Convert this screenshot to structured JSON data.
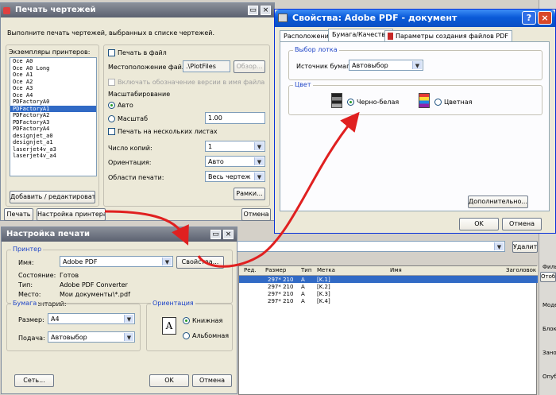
{
  "plot_dialog": {
    "title": "Печать чертежей",
    "instruction": "Выполните печать чертежей, выбранных в списке чертежей.",
    "printers_label": "Экземпляры принтеров:",
    "printers": [
      "Oce A0",
      "Oce A0 Long",
      "Oce A1",
      "Oce A2",
      "Oce A3",
      "Oce A4",
      "PDFactoryA0",
      "PDFactoryA1",
      "PDFactoryA2",
      "PDFactoryA3",
      "PDFactoryA4",
      "designjet_a0",
      "designjet_a1",
      "laserjet4v_a3",
      "laserjet4v_a4"
    ],
    "selected_printer_index": 7,
    "add_edit_button": "Добавить / редактировать...",
    "print_to_file": "Печать в файл",
    "file_location_label": "Местоположение файлов:",
    "file_location_value": ".\\PlotFiles",
    "browse_button": "Обзор...",
    "include_version": "Включать обозначение версии в имя файла",
    "scaling_label": "Масштабирование",
    "auto": "Авто",
    "scale": "Масштаб",
    "scale_value": "1.00",
    "multi_sheet": "Печать на нескольких листах",
    "copies_label": "Число копий:",
    "copies_value": "1",
    "orientation_label": "Ориентация:",
    "orientation_value": "Авто",
    "print_area_label": "Области печати:",
    "print_area_value": "Весь чертеж",
    "frames_button": "Рамки...",
    "print_button": "Печать",
    "printer_setup_button": "Настройка принтера...",
    "cancel_button": "Отмена"
  },
  "pdf_props": {
    "title": "Свойства: Adobe PDF - документ",
    "tabs": [
      "Расположение",
      "Бумага/Качество",
      "Параметры создания файлов PDF"
    ],
    "active_tab": 1,
    "tray_group": "Выбор лотка",
    "paper_source_label": "Источник бумаги:",
    "paper_source_value": "Автовыбор",
    "color_group": "Цвет",
    "bw": "Черно-белая",
    "color": "Цветная",
    "advanced_button": "Дополнительно...",
    "ok": "OK",
    "cancel": "Отмена"
  },
  "print_setup": {
    "title": "Настройка печати",
    "printer_group": "Принтер",
    "name_label": "Имя:",
    "name_value": "Adobe PDF",
    "properties_button": "Свойства...",
    "status_label": "Состояние:",
    "status_value": "Готов",
    "type_label": "Тип:",
    "type_value": "Adobe PDF Converter",
    "where_label": "Место:",
    "where_value": "Мои документы\\*.pdf",
    "comment_label": "Комментарий:",
    "paper_group": "Бумага",
    "size_label": "Размер:",
    "size_value": "A4",
    "source_label": "Подача:",
    "source_value": "Автовыбор",
    "orientation_group": "Ориентация",
    "portrait": "Книжная",
    "landscape": "Альбомная",
    "network_button": "Сеть...",
    "ok": "OK",
    "cancel": "Отмена"
  },
  "background": {
    "delete_button": "Удалить",
    "columns": [
      "Ред.",
      "Размер",
      "Тип",
      "Метка",
      "Имя",
      "Заголовок"
    ],
    "rows": [
      {
        "size": "297* 210",
        "type": "A",
        "label": "[K.1]"
      },
      {
        "size": "297* 210",
        "type": "A",
        "label": "[K.2]"
      },
      {
        "size": "297* 210",
        "type": "A",
        "label": "[K.3]"
      },
      {
        "size": "297* 210",
        "type": "A",
        "label": "[K.4]"
      }
    ],
    "side_labels": [
      "Филь",
      "Отоб",
      "Моде",
      "Блок",
      "Заноу",
      "Опуб"
    ]
  },
  "colors": {
    "annotation_red": "#e02020",
    "selection": "#316ac5",
    "xp_blue": "#0a5ad8"
  }
}
